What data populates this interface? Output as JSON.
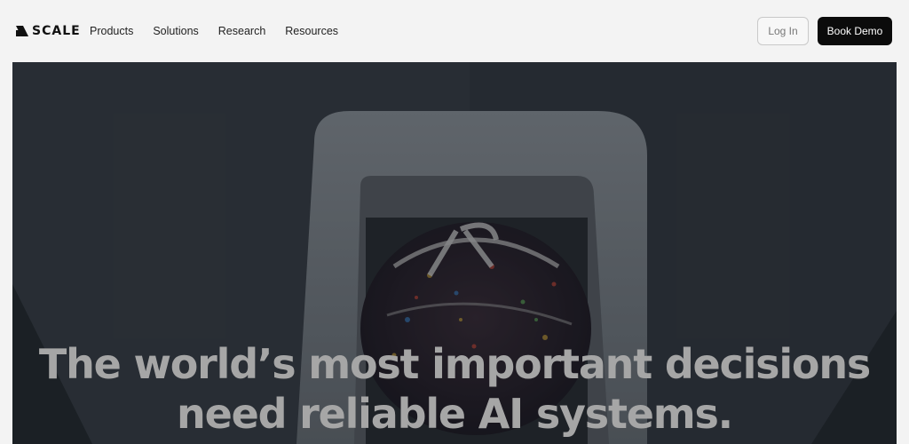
{
  "brand": {
    "name": "SCALE",
    "logo_icon": "scale-logo-icon"
  },
  "nav": {
    "links": [
      "Products",
      "Solutions",
      "Research",
      "Resources"
    ],
    "login_label": "Log In",
    "demo_label": "Book Demo"
  },
  "hero": {
    "headline_line1": "The world’s most important decisions",
    "headline_line2": "need reliable AI systems."
  },
  "colors": {
    "page_bg": "#f3f3f3",
    "demo_button_bg": "#0b0b0b",
    "hero_bg": "#31373e",
    "headline_text": "#a6a6a6"
  }
}
